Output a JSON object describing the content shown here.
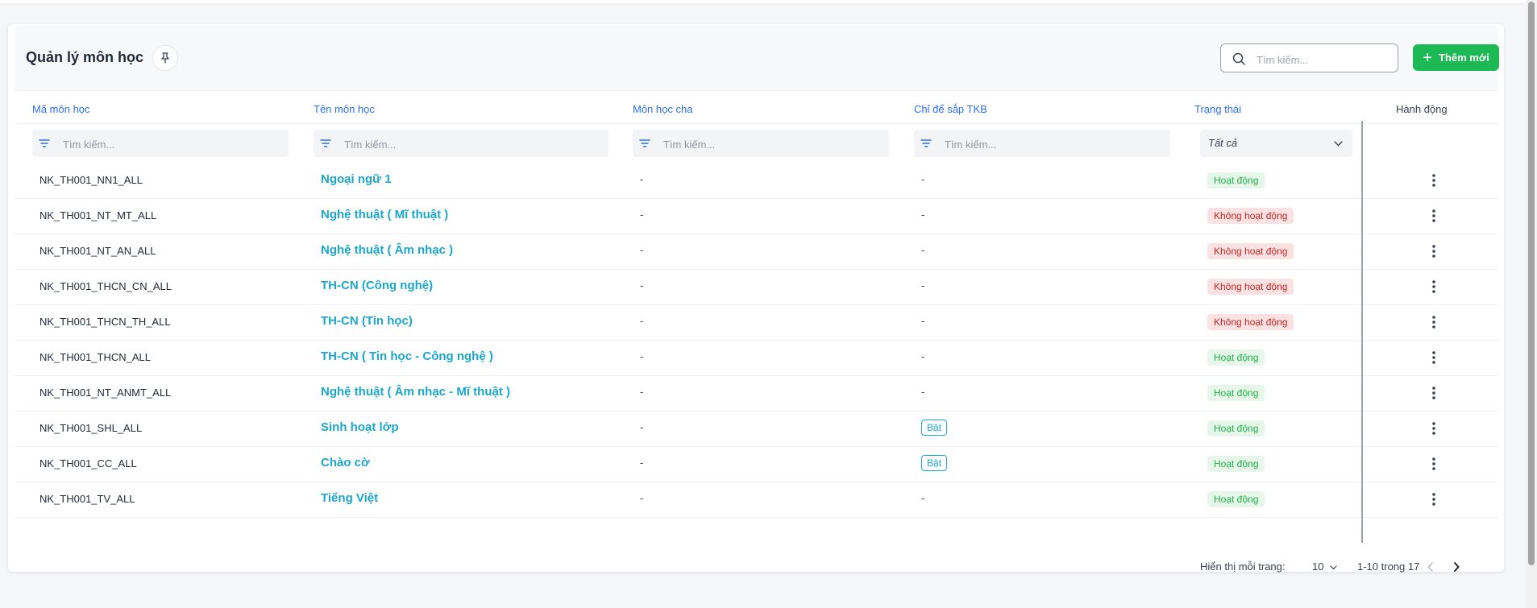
{
  "header": {
    "title": "Quản lý môn học",
    "search_placeholder": "Tìm kiếm...",
    "add_label": "Thêm mới"
  },
  "columns": [
    "Mã môn học",
    "Tên môn học",
    "Môn học cha",
    "Chỉ để sắp TKB",
    "Trạng thái",
    "Hành động"
  ],
  "filters": {
    "placeholder": "Tìm kiếm...",
    "status_value": "Tất cả"
  },
  "rows": [
    {
      "code": "NK_TH001_NN1_ALL",
      "name": "Ngoại ngữ 1",
      "parent": "-",
      "tkb": "-",
      "status": "Hoạt động"
    },
    {
      "code": "NK_TH001_NT_MT_ALL",
      "name": "Nghệ thuật ( Mĩ thuật )",
      "parent": "-",
      "tkb": "-",
      "status": "Không hoạt động"
    },
    {
      "code": "NK_TH001_NT_AN_ALL",
      "name": "Nghệ thuật ( Âm nhạc )",
      "parent": "-",
      "tkb": "-",
      "status": "Không hoạt động"
    },
    {
      "code": "NK_TH001_THCN_CN_ALL",
      "name": "TH-CN (Công nghệ)",
      "parent": "-",
      "tkb": "-",
      "status": "Không hoạt động"
    },
    {
      "code": "NK_TH001_THCN_TH_ALL",
      "name": "TH-CN (Tin học)",
      "parent": "-",
      "tkb": "-",
      "status": "Không hoạt động"
    },
    {
      "code": "NK_TH001_THCN_ALL",
      "name": "TH-CN ( Tin học - Công nghệ )",
      "parent": "-",
      "tkb": "-",
      "status": "Hoạt động"
    },
    {
      "code": "NK_TH001_NT_ANMT_ALL",
      "name": "Nghệ thuật ( Âm nhạc - Mĩ thuật )",
      "parent": "-",
      "tkb": "-",
      "status": "Hoạt động"
    },
    {
      "code": "NK_TH001_SHL_ALL",
      "name": "Sinh hoạt lớp",
      "parent": "-",
      "tkb": "Bật",
      "status": "Hoạt động"
    },
    {
      "code": "NK_TH001_CC_ALL",
      "name": "Chào cờ",
      "parent": "-",
      "tkb": "Bật",
      "status": "Hoạt động"
    },
    {
      "code": "NK_TH001_TV_ALL",
      "name": "Tiếng Việt",
      "parent": "-",
      "tkb": "-",
      "status": "Hoạt động"
    }
  ],
  "pagination": {
    "per_page_label": "Hiển thị mỗi trang:",
    "per_page_value": "10",
    "range_text": "1-10 trong 17"
  },
  "icons": {
    "pin": "pin-icon",
    "search": "search-icon",
    "plus": "plus-icon",
    "filter": "filter-icon",
    "chevron": "chevron-down-icon",
    "more": "more-vertical-icon",
    "prev": "chevron-left-icon",
    "next": "chevron-right-icon"
  },
  "colors": {
    "accent": "#2f6fea",
    "primary_button": "#1db954",
    "subject_name": "#19a7cc",
    "active_bg": "#e6f7ea",
    "active_text": "#21b04b",
    "inactive_bg": "#fbe2e2",
    "inactive_text": "#c62828"
  }
}
